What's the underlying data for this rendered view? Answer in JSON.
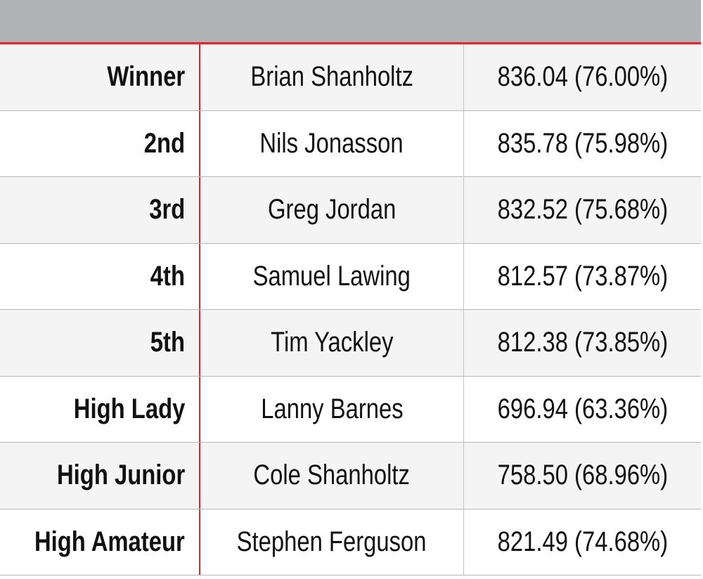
{
  "colors": {
    "header": "#b1b3b6",
    "accent": "#e0282c"
  },
  "rows": [
    {
      "place": "Winner",
      "name": "Brian Shanholtz",
      "score": "836.04 (76.00%)"
    },
    {
      "place": "2nd",
      "name": "Nils Jonasson",
      "score": "835.78 (75.98%)"
    },
    {
      "place": "3rd",
      "name": "Greg Jordan",
      "score": "832.52 (75.68%)"
    },
    {
      "place": "4th",
      "name": "Samuel Lawing",
      "score": "812.57 (73.87%)"
    },
    {
      "place": "5th",
      "name": "Tim Yackley",
      "score": "812.38 (73.85%)"
    },
    {
      "place": "High Lady",
      "name": "Lanny Barnes",
      "score": "696.94 (63.36%)"
    },
    {
      "place": "High Junior",
      "name": "Cole Shanholtz",
      "score": "758.50 (68.96%)"
    },
    {
      "place": "High Amateur",
      "name": "Stephen Ferguson",
      "score": "821.49 (74.68%)"
    }
  ]
}
